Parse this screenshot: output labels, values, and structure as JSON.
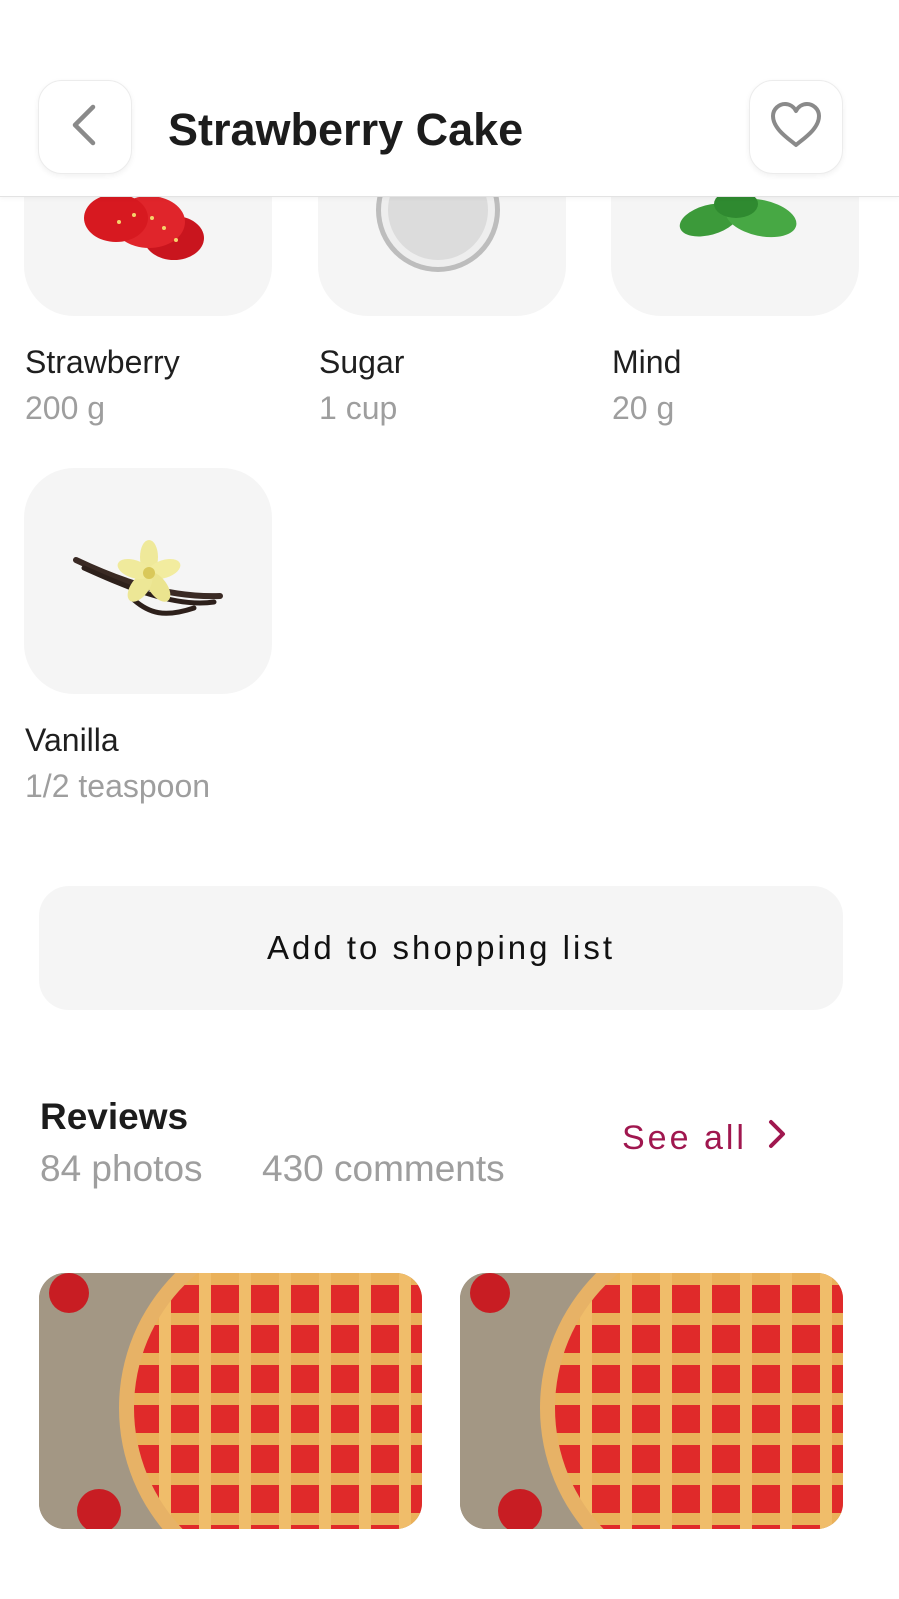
{
  "header": {
    "title": "Strawberry Cake",
    "back_icon": "chevron-left-icon",
    "favorite_icon": "heart-outline-icon"
  },
  "ingredients": [
    {
      "name": "Strawberry",
      "quantity": "200 g",
      "image": "strawberry"
    },
    {
      "name": "Sugar",
      "quantity": "1 cup",
      "image": "sugar-bowl"
    },
    {
      "name": "Mind",
      "quantity": "20 g",
      "image": "mint-leaves"
    },
    {
      "name": "Vanilla",
      "quantity": "1/2 teaspoon",
      "image": "vanilla-pods"
    }
  ],
  "shopping": {
    "button_label": "Add to shopping list"
  },
  "reviews": {
    "title": "Reviews",
    "photos": "84 photos",
    "comments": "430 comments",
    "see_all": "See all",
    "images": [
      "strawberry-lattice-pie",
      "strawberry-lattice-pie"
    ]
  },
  "colors": {
    "accent": "#a0174f",
    "tile_bg": "#f5f5f5",
    "muted_text": "#9e9e9e"
  }
}
